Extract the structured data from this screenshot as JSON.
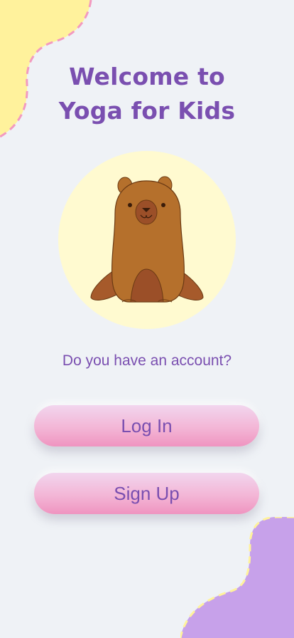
{
  "welcome": {
    "title_line1": "Welcome to",
    "title_line2": "Yoga for Kids"
  },
  "mascot": {
    "icon": "capybara-icon"
  },
  "account": {
    "question": "Do you have an account?",
    "login_label": "Log In",
    "signup_label": "Sign Up"
  },
  "colors": {
    "background": "#eff2f6",
    "accent_purple": "#7a4fb0",
    "blob_yellow": "#fff29c",
    "blob_purple": "#c7a1ea",
    "button_pink": "#f3b6d6"
  }
}
